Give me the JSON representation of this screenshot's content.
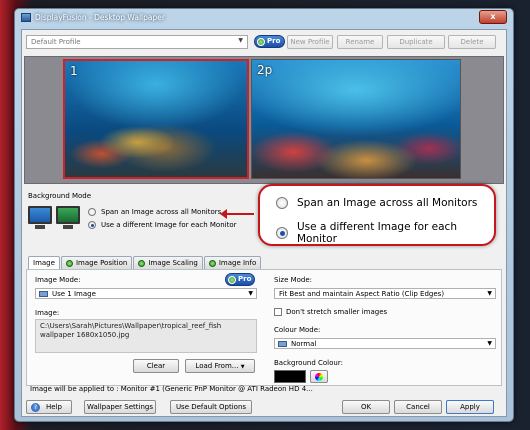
{
  "window": {
    "title": "DisplayFusion - Desktop Wallpaper",
    "close_label": "x"
  },
  "toolbar": {
    "profile_value": "Default Profile",
    "pro_label": "Pro",
    "new_profile": "New Profile",
    "rename": "Rename",
    "duplicate": "Duplicate",
    "delete": "Delete"
  },
  "monitors": [
    {
      "label": "1",
      "selected": true
    },
    {
      "label": "2p",
      "selected": false
    }
  ],
  "background_mode": {
    "label": "Background Mode",
    "options": [
      {
        "label": "Span an Image across all Monitors",
        "selected": false
      },
      {
        "label": "Use a different Image for each Monitor",
        "selected": true
      }
    ]
  },
  "callout": {
    "options": [
      {
        "label": "Span an Image across all Monitors",
        "selected": false
      },
      {
        "label": "Use a different Image for each Monitor",
        "selected": true
      }
    ]
  },
  "tabs": [
    {
      "label": "Image",
      "active": true,
      "icon": false
    },
    {
      "label": "Image Position",
      "active": false,
      "icon": true
    },
    {
      "label": "Image Scaling",
      "active": false,
      "icon": true
    },
    {
      "label": "Image Info",
      "active": false,
      "icon": true
    }
  ],
  "image_panel": {
    "image_mode_label": "Image Mode:",
    "pro_label": "Pro",
    "image_mode_value": "Use 1 Image",
    "image_label": "Image:",
    "image_path": "C:\\Users\\Sarah\\Pictures\\Wallpaper\\tropical_reef_fish wallpaper 1680x1050.jpg",
    "clear": "Clear",
    "load_from": "Load From...",
    "size_mode_label": "Size Mode:",
    "size_mode_value": "Fit Best and maintain Aspect Ratio (Clip Edges)",
    "dont_stretch": "Don't stretch smaller images",
    "colour_mode_label": "Colour Mode:",
    "colour_mode_value": "Normal",
    "background_colour_label": "Background Colour:",
    "background_colour": "#000000"
  },
  "applied_to": "Image will be applied to : Monitor #1 (Generic PnP Monitor @ ATI Radeon HD 4...",
  "footer": {
    "help": "Help",
    "wallpaper_settings": "Wallpaper Settings",
    "use_default_options": "Use Default Options",
    "ok": "OK",
    "cancel": "Cancel",
    "apply": "Apply"
  },
  "colors": {
    "accent_red": "#c4161c",
    "pro_blue": "#1a4ea8"
  }
}
